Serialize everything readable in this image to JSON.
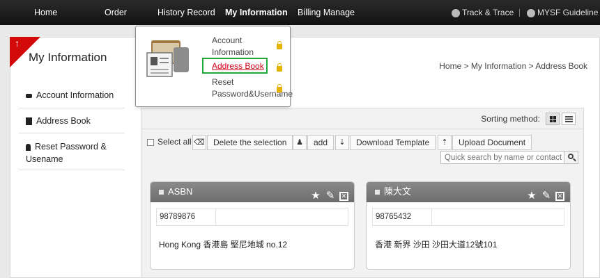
{
  "nav": {
    "items": [
      "Home",
      "Order",
      "History Record",
      "My Information",
      "Billing Manage"
    ],
    "active": "My Information",
    "track": "Track & Trace",
    "guide": "MYSF Guideline"
  },
  "page": {
    "title": "My Information",
    "breadcrumb": "Home > My Information > Address Book",
    "accent_color": "#d20a0a"
  },
  "dropdown": {
    "items": [
      {
        "label": "Account\nInformation"
      },
      {
        "label": "Address Book"
      },
      {
        "label": "Reset\nPassword&Username"
      }
    ]
  },
  "sidebar": {
    "items": [
      {
        "label": "Account Information"
      },
      {
        "label": "Address Book"
      },
      {
        "label": "Reset Password & Usename"
      }
    ]
  },
  "content": {
    "sort_label": "Sorting method:",
    "select_all": "Select all",
    "delete_selection": "Delete the selection",
    "add": "add",
    "download_template": "Download Template",
    "upload_document": "Upload Document",
    "search_placeholder": "Quick search by name or contact"
  },
  "cards": [
    {
      "name": "ASBN",
      "phone": "98789876",
      "address": "Hong Kong 香港島 堅尼地城 no.12"
    },
    {
      "name": "陳大文",
      "phone": "98765432",
      "address": "香港 新界 沙田 沙田大道12號101"
    }
  ]
}
